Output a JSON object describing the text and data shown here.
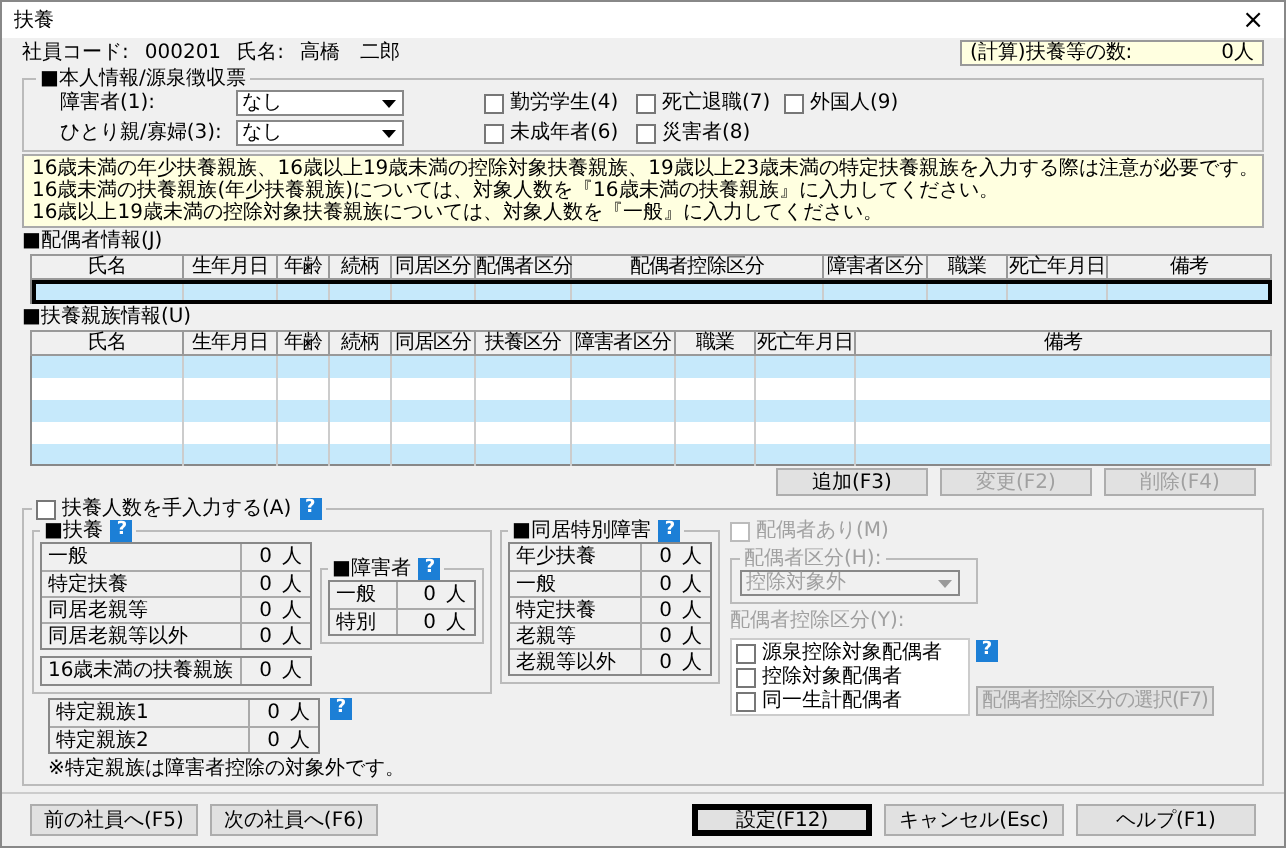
{
  "window": {
    "title": "扶養",
    "close": "×"
  },
  "employee": {
    "code_label": "社員コード:",
    "code": "000201",
    "name_label": "氏名:",
    "name": "高橋　二郎"
  },
  "computed": {
    "label": "(計算)扶養等の数:",
    "value": "0人"
  },
  "personal": {
    "title": "■本人情報/源泉徴収票",
    "selects": [
      {
        "label": "障害者(1):",
        "value": "なし"
      },
      {
        "label": "ひとり親/寡婦(3):",
        "value": "なし"
      }
    ],
    "checkboxes": [
      {
        "label": "勤労学生(4)",
        "checked": false
      },
      {
        "label": "死亡退職(7)",
        "checked": false
      },
      {
        "label": "外国人(9)",
        "checked": false
      },
      {
        "label": "未成年者(6)",
        "checked": false
      },
      {
        "label": "災害者(8)",
        "checked": false
      }
    ]
  },
  "notice": [
    "16歳未満の年少扶養親族、16歳以上19歳未満の控除対象扶養親族、19歳以上23歳未満の特定扶養親族を入力する際は注意が必要です。",
    "16歳未満の扶養親族(年少扶養親族)については、対象人数を『16歳未満の扶養親族』に入力してください。",
    "16歳以上19歳未満の控除対象扶養親族については、対象人数を『一般』に入力してください。"
  ],
  "spouse_table": {
    "title": "■配偶者情報(J)",
    "columns": [
      "氏名",
      "生年月日",
      "年齢",
      "続柄",
      "同居区分",
      "配偶者区分",
      "配偶者控除区分",
      "障害者区分",
      "職業",
      "死亡年月日",
      "備考"
    ],
    "rows": [
      {
        "selected": true
      }
    ]
  },
  "dependents_table": {
    "title": "■扶養親族情報(U)",
    "columns": [
      "氏名",
      "生年月日",
      "年齢",
      "続柄",
      "同居区分",
      "扶養区分",
      "障害者区分",
      "職業",
      "死亡年月日",
      "備考"
    ],
    "rows": [
      {
        "selected": false
      },
      {
        "selected": false
      },
      {
        "selected": false
      },
      {
        "selected": false
      },
      {
        "selected": false
      }
    ]
  },
  "table_buttons": [
    {
      "label": "追加(F3)",
      "disabled": false
    },
    {
      "label": "変更(F2)",
      "disabled": true
    },
    {
      "label": "削除(F4)",
      "disabled": true
    }
  ],
  "manual": {
    "label": "扶養人数を手入力する(A)",
    "checked": false,
    "help": "?"
  },
  "dependents_group": {
    "title": "■扶養",
    "help": "?",
    "rows": [
      {
        "label": "一般",
        "value": "0",
        "unit": "人"
      },
      {
        "label": "特定扶養",
        "value": "0",
        "unit": "人"
      },
      {
        "label": "同居老親等",
        "value": "0",
        "unit": "人"
      },
      {
        "label": "同居老親等以外",
        "value": "0",
        "unit": "人"
      }
    ],
    "under16": {
      "label": "16歳未満の扶養親族",
      "value": "0",
      "unit": "人"
    }
  },
  "disabled_group": {
    "title": "■障害者",
    "help": "?",
    "rows": [
      {
        "label": "一般",
        "value": "0",
        "unit": "人"
      },
      {
        "label": "特別",
        "value": "0",
        "unit": "人"
      }
    ]
  },
  "special_group": {
    "title": "■同居特別障害",
    "help": "?",
    "rows": [
      {
        "label": "年少扶養",
        "value": "0",
        "unit": "人"
      },
      {
        "label": "一般",
        "value": "0",
        "unit": "人"
      },
      {
        "label": "特定扶養",
        "value": "0",
        "unit": "人"
      },
      {
        "label": "老親等",
        "value": "0",
        "unit": "人"
      },
      {
        "label": "老親等以外",
        "value": "0",
        "unit": "人"
      }
    ]
  },
  "specific_relatives": {
    "help": "?",
    "rows": [
      {
        "label": "特定親族1",
        "value": "0",
        "unit": "人"
      },
      {
        "label": "特定親族2",
        "value": "0",
        "unit": "人"
      }
    ],
    "note": "※特定親族は障害者控除の対象外です。"
  },
  "spouse_settings": {
    "has_spouse": {
      "label": "配偶者あり(M)",
      "checked": false,
      "disabled": true
    },
    "category": {
      "title": "配偶者区分(H):",
      "value": "控除対象外",
      "disabled": true
    },
    "deduction": {
      "title": "配偶者控除区分(Y):",
      "help": "?",
      "items": [
        {
          "label": "源泉控除対象配偶者",
          "checked": false
        },
        {
          "label": "控除対象配偶者",
          "checked": false
        },
        {
          "label": "同一生計配偶者",
          "checked": false
        }
      ]
    },
    "select_button": {
      "label": "配偶者控除区分の選択(F7)",
      "disabled": true
    }
  },
  "footer_left": [
    {
      "label": "前の社員へ(F5)"
    },
    {
      "label": "次の社員へ(F6)"
    }
  ],
  "footer_right": [
    {
      "label": "設定(F12)",
      "focused": true
    },
    {
      "label": "キャンセル(Esc)",
      "focused": false
    },
    {
      "label": "ヘルプ(F1)",
      "focused": false
    }
  ]
}
